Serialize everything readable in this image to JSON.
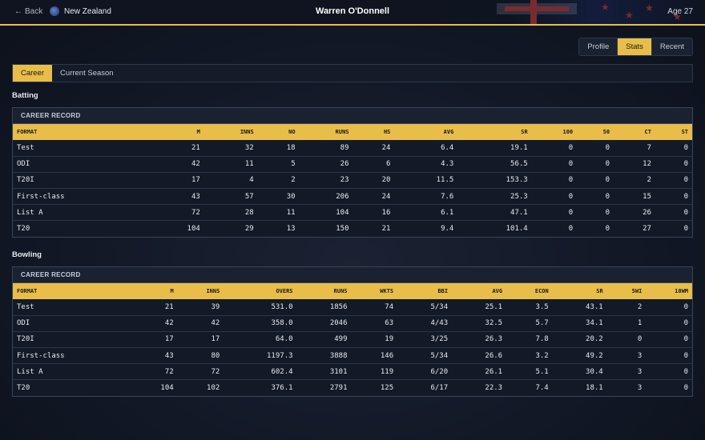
{
  "header": {
    "back_label": "Back",
    "country": "New Zealand",
    "player_name": "Warren O'Donnell",
    "age": "Age 27"
  },
  "view_tabs": [
    "Profile",
    "Stats",
    "Recent"
  ],
  "active_view_tab": "Stats",
  "sub_tabs": [
    "Career",
    "Current Season"
  ],
  "active_sub_tab": "Career",
  "colors": {
    "accent": "#e8bd4a",
    "background": "#121826"
  },
  "batting": {
    "section_title": "Batting",
    "panel_title": "CAREER RECORD",
    "columns": [
      "FORMAT",
      "M",
      "INNS",
      "NO",
      "RUNS",
      "HS",
      "AVG",
      "SR",
      "100",
      "50",
      "CT",
      "ST"
    ],
    "rows": [
      [
        "Test",
        "21",
        "32",
        "18",
        "89",
        "24",
        "6.4",
        "19.1",
        "0",
        "0",
        "7",
        "0"
      ],
      [
        "ODI",
        "42",
        "11",
        "5",
        "26",
        "6",
        "4.3",
        "56.5",
        "0",
        "0",
        "12",
        "0"
      ],
      [
        "T20I",
        "17",
        "4",
        "2",
        "23",
        "20",
        "11.5",
        "153.3",
        "0",
        "0",
        "2",
        "0"
      ],
      [
        "First-class",
        "43",
        "57",
        "30",
        "206",
        "24",
        "7.6",
        "25.3",
        "0",
        "0",
        "15",
        "0"
      ],
      [
        "List A",
        "72",
        "28",
        "11",
        "104",
        "16",
        "6.1",
        "47.1",
        "0",
        "0",
        "26",
        "0"
      ],
      [
        "T20",
        "104",
        "29",
        "13",
        "150",
        "21",
        "9.4",
        "101.4",
        "0",
        "0",
        "27",
        "0"
      ]
    ]
  },
  "bowling": {
    "section_title": "Bowling",
    "panel_title": "CAREER RECORD",
    "columns": [
      "FORMAT",
      "M",
      "INNS",
      "OVERS",
      "RUNS",
      "WKTS",
      "BBI",
      "AVG",
      "ECON",
      "SR",
      "5WI",
      "10WM"
    ],
    "rows": [
      [
        "Test",
        "21",
        "39",
        "531.0",
        "1856",
        "74",
        "5/34",
        "25.1",
        "3.5",
        "43.1",
        "2",
        "0"
      ],
      [
        "ODI",
        "42",
        "42",
        "358.0",
        "2046",
        "63",
        "4/43",
        "32.5",
        "5.7",
        "34.1",
        "1",
        "0"
      ],
      [
        "T20I",
        "17",
        "17",
        "64.0",
        "499",
        "19",
        "3/25",
        "26.3",
        "7.8",
        "20.2",
        "0",
        "0"
      ],
      [
        "First-class",
        "43",
        "80",
        "1197.3",
        "3888",
        "146",
        "5/34",
        "26.6",
        "3.2",
        "49.2",
        "3",
        "0"
      ],
      [
        "List A",
        "72",
        "72",
        "602.4",
        "3101",
        "119",
        "6/20",
        "26.1",
        "5.1",
        "30.4",
        "3",
        "0"
      ],
      [
        "T20",
        "104",
        "102",
        "376.1",
        "2791",
        "125",
        "6/17",
        "22.3",
        "7.4",
        "18.1",
        "3",
        "0"
      ]
    ]
  }
}
